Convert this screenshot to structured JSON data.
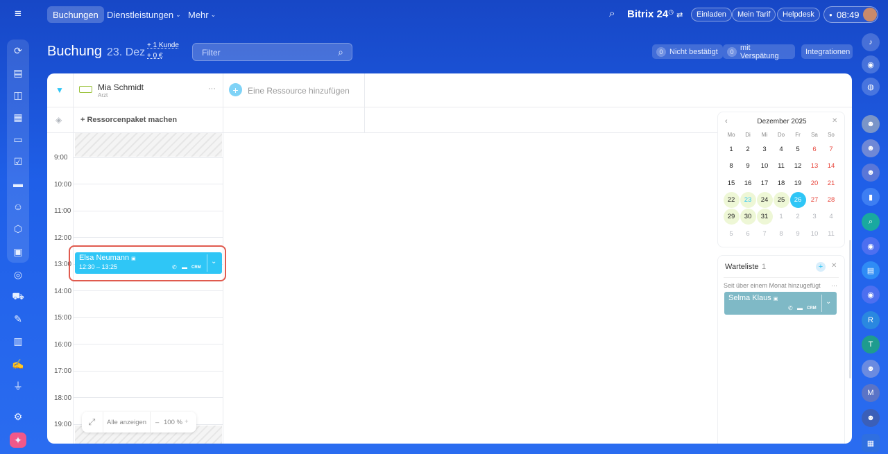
{
  "topbar": {
    "nav": [
      "Buchungen",
      "Dienstleistungen",
      "Mehr"
    ],
    "brand": "Bitrix 24",
    "pills": [
      "Einladen",
      "Mein Tarif",
      "Helpdesk"
    ],
    "clock": "08:49"
  },
  "header": {
    "title": "Buchung",
    "date": "23. Dez",
    "delta_customers": "+ 1 Kunde",
    "delta_money": "+ 0 €",
    "filter_placeholder": "Filter",
    "not_confirmed_count": "0",
    "not_confirmed_label": "Nicht bestätigt",
    "late_count": "0",
    "late_label": "mit Verspätung",
    "integrations": "Integrationen"
  },
  "resource": {
    "name": "Mia Schmidt",
    "role": "Arzt",
    "more": "···",
    "add_label": "Eine Ressource hinzufügen",
    "package_label": "+ Ressorcenpaket machen"
  },
  "times": [
    "9:00",
    "10:00",
    "11:00",
    "12:00",
    "13:00",
    "14:00",
    "15:00",
    "16:00",
    "17:00",
    "18:00",
    "19:00"
  ],
  "booking": {
    "client": "Elsa Neumann",
    "time_range": "12:30 – 13:25",
    "crm": "CRM"
  },
  "zoom": {
    "show_all": "Alle anzeigen",
    "minus": "–",
    "level": "100 %",
    "plus": "+"
  },
  "calendar": {
    "month": "Dezember 2025",
    "weekdays": [
      "Mo",
      "Di",
      "Mi",
      "Do",
      "Fr",
      "Sa",
      "So"
    ],
    "weeks": [
      [
        "1",
        "2",
        "3",
        "4",
        "5",
        "6",
        "7"
      ],
      [
        "8",
        "9",
        "10",
        "11",
        "12",
        "13",
        "14"
      ],
      [
        "15",
        "16",
        "17",
        "18",
        "19",
        "20",
        "21"
      ],
      [
        "22",
        "23",
        "24",
        "25",
        "26",
        "27",
        "28"
      ],
      [
        "29",
        "30",
        "31",
        "1",
        "2",
        "3",
        "4"
      ],
      [
        "5",
        "6",
        "7",
        "8",
        "9",
        "10",
        "11"
      ]
    ],
    "selected": "26",
    "today": "23"
  },
  "waitlist": {
    "title": "Warteliste",
    "count": "1",
    "subtitle": "Seit über einem Monat hinzugefügt",
    "more": "···",
    "client": "Selma Klaus",
    "crm": "CRM"
  },
  "rightrail_letters": [
    "R",
    "T",
    "M"
  ],
  "colors": {
    "accent": "#2fc6f6",
    "highlight": "#e05a4e",
    "weekend": "#e8463c",
    "waitcard": "#7fb9c6"
  }
}
